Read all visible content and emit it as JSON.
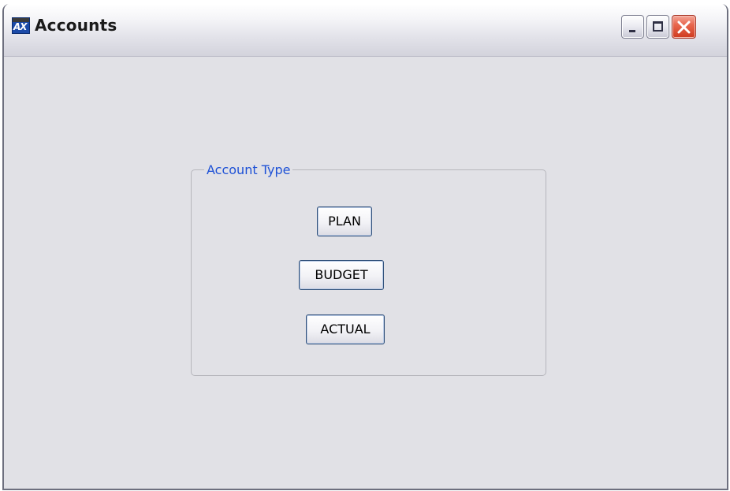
{
  "window": {
    "title": "Accounts",
    "icon": "app-chart-icon"
  },
  "title_controls": {
    "minimize_icon": "minimize-icon",
    "maximize_icon": "maximize-icon",
    "close_icon": "close-icon"
  },
  "account_type": {
    "legend": "Account Type",
    "buttons": {
      "plan": "PLAN",
      "budget": "BUDGET",
      "actual": "ACTUAL"
    }
  },
  "colors": {
    "legend_text": "#1f52d6",
    "client_background": "#e1e1e6",
    "close_button": "#e8674e"
  }
}
